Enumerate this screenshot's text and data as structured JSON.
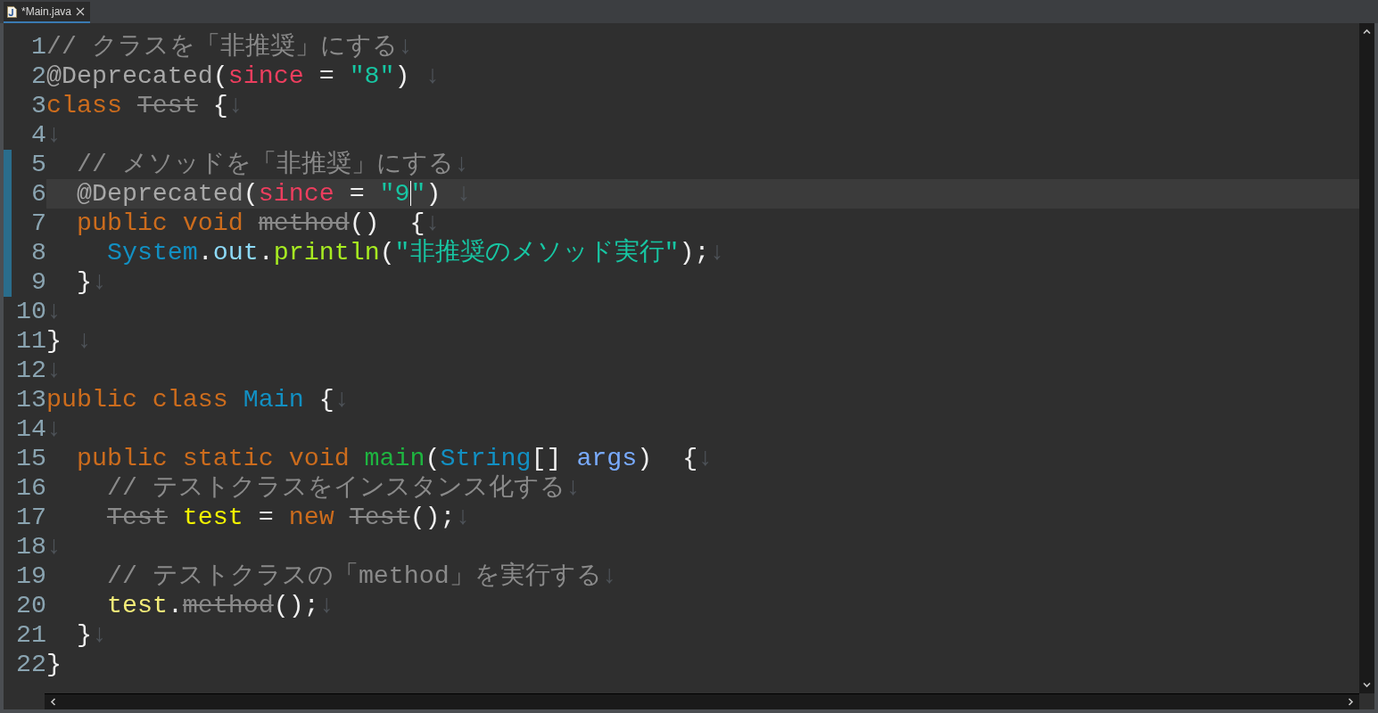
{
  "tabs": [
    {
      "title": "*Main.java",
      "selected": true
    }
  ],
  "lines": [
    {
      "number": "1",
      "changed": false,
      "current": false,
      "tokens": [
        {
          "text": "// クラスを「非推奨」にする",
          "kind": "comment"
        },
        {
          "text": "↓",
          "kind": "eol"
        }
      ]
    },
    {
      "number": "2",
      "changed": false,
      "current": false,
      "tokens": [
        {
          "text": "@Deprecated",
          "kind": "annotation"
        },
        {
          "text": "(",
          "kind": "plain"
        },
        {
          "text": "since",
          "kind": "attr"
        },
        {
          "text": " = ",
          "kind": "plain"
        },
        {
          "text": "\"8\"",
          "kind": "string"
        },
        {
          "text": ")",
          "kind": "plain"
        },
        {
          "text": " ↓",
          "kind": "eol"
        }
      ]
    },
    {
      "number": "3",
      "changed": false,
      "current": false,
      "tokens": [
        {
          "text": "class ",
          "kind": "keyword"
        },
        {
          "text": "Test",
          "kind": "deprecated"
        },
        {
          "text": " {",
          "kind": "plain"
        },
        {
          "text": "↓",
          "kind": "eol"
        }
      ]
    },
    {
      "number": "4",
      "changed": false,
      "current": false,
      "tokens": [
        {
          "text": "↓",
          "kind": "eol"
        }
      ]
    },
    {
      "number": "5",
      "changed": true,
      "current": false,
      "tokens": [
        {
          "text": "  // メソッドを「非推奨」にする",
          "kind": "comment"
        },
        {
          "text": "↓",
          "kind": "eol"
        }
      ]
    },
    {
      "number": "6",
      "changed": true,
      "current": true,
      "tokens": [
        {
          "text": "  @Deprecated",
          "kind": "annotation"
        },
        {
          "text": "(",
          "kind": "plain"
        },
        {
          "text": "since",
          "kind": "attr"
        },
        {
          "text": " = ",
          "kind": "plain"
        },
        {
          "text": "\"9",
          "kind": "string"
        },
        {
          "kind": "caret"
        },
        {
          "text": "\"",
          "kind": "string"
        },
        {
          "text": ")",
          "kind": "plain"
        },
        {
          "text": " ↓",
          "kind": "eol"
        }
      ]
    },
    {
      "number": "7",
      "changed": true,
      "current": false,
      "tokens": [
        {
          "text": "  public void ",
          "kind": "keyword"
        },
        {
          "text": "method",
          "kind": "deprecated"
        },
        {
          "text": "()  {",
          "kind": "plain"
        },
        {
          "text": "↓",
          "kind": "eol"
        }
      ]
    },
    {
      "number": "8",
      "changed": true,
      "current": false,
      "tokens": [
        {
          "text": "    System",
          "kind": "type"
        },
        {
          "text": ".",
          "kind": "plain"
        },
        {
          "text": "out",
          "kind": "field"
        },
        {
          "text": ".",
          "kind": "plain"
        },
        {
          "text": "println",
          "kind": "method"
        },
        {
          "text": "(",
          "kind": "plain"
        },
        {
          "text": "\"非推奨のメソッド実行\"",
          "kind": "string"
        },
        {
          "text": ");",
          "kind": "plain"
        },
        {
          "text": "↓",
          "kind": "eol"
        }
      ]
    },
    {
      "number": "9",
      "changed": true,
      "current": false,
      "tokens": [
        {
          "text": "  }",
          "kind": "plain"
        },
        {
          "text": "↓",
          "kind": "eol"
        }
      ]
    },
    {
      "number": "10",
      "changed": false,
      "current": false,
      "tokens": [
        {
          "text": "↓",
          "kind": "eol"
        }
      ]
    },
    {
      "number": "11",
      "changed": false,
      "current": false,
      "tokens": [
        {
          "text": "}",
          "kind": "plain"
        },
        {
          "text": " ↓",
          "kind": "eol"
        }
      ]
    },
    {
      "number": "12",
      "changed": false,
      "current": false,
      "tokens": [
        {
          "text": "↓",
          "kind": "eol"
        }
      ]
    },
    {
      "number": "13",
      "changed": false,
      "current": false,
      "tokens": [
        {
          "text": "public class ",
          "kind": "keyword"
        },
        {
          "text": "Main",
          "kind": "type"
        },
        {
          "text": " {",
          "kind": "plain"
        },
        {
          "text": "↓",
          "kind": "eol"
        }
      ]
    },
    {
      "number": "14",
      "changed": false,
      "current": false,
      "tokens": [
        {
          "text": "↓",
          "kind": "eol"
        }
      ]
    },
    {
      "number": "15",
      "changed": false,
      "current": false,
      "tokens": [
        {
          "text": "  public static void ",
          "kind": "keyword"
        },
        {
          "text": "main",
          "kind": "decl"
        },
        {
          "text": "(",
          "kind": "plain"
        },
        {
          "text": "String",
          "kind": "type"
        },
        {
          "text": "[] ",
          "kind": "plain"
        },
        {
          "text": "args",
          "kind": "param"
        },
        {
          "text": ")  {",
          "kind": "plain"
        },
        {
          "text": "↓",
          "kind": "eol"
        }
      ]
    },
    {
      "number": "16",
      "changed": false,
      "current": false,
      "tokens": [
        {
          "text": "    // テストクラスをインスタンス化する",
          "kind": "comment"
        },
        {
          "text": "↓",
          "kind": "eol"
        }
      ]
    },
    {
      "number": "17",
      "changed": false,
      "current": false,
      "tokens": [
        {
          "text": "    Test",
          "kind": "deprecated"
        },
        {
          "text": " test",
          "kind": "local"
        },
        {
          "text": " = ",
          "kind": "plain"
        },
        {
          "text": "new ",
          "kind": "keyword"
        },
        {
          "text": "Test",
          "kind": "deprecated"
        },
        {
          "text": "();",
          "kind": "plain"
        },
        {
          "text": "↓",
          "kind": "eol"
        }
      ]
    },
    {
      "number": "18",
      "changed": false,
      "current": false,
      "tokens": [
        {
          "text": "↓",
          "kind": "eol"
        }
      ]
    },
    {
      "number": "19",
      "changed": false,
      "current": false,
      "tokens": [
        {
          "text": "    // テストクラスの「method」を実行する",
          "kind": "comment"
        },
        {
          "text": "↓",
          "kind": "eol"
        }
      ]
    },
    {
      "number": "20",
      "changed": false,
      "current": false,
      "tokens": [
        {
          "text": "    test",
          "kind": "localref"
        },
        {
          "text": ".",
          "kind": "plain"
        },
        {
          "text": "method",
          "kind": "deprecated"
        },
        {
          "text": "();",
          "kind": "plain"
        },
        {
          "text": "↓",
          "kind": "eol"
        }
      ]
    },
    {
      "number": "21",
      "changed": false,
      "current": false,
      "tokens": [
        {
          "text": "  }",
          "kind": "plain"
        },
        {
          "text": "↓",
          "kind": "eol"
        }
      ]
    },
    {
      "number": "22",
      "changed": false,
      "current": false,
      "tokens": [
        {
          "text": "}",
          "kind": "plain"
        }
      ]
    }
  ]
}
